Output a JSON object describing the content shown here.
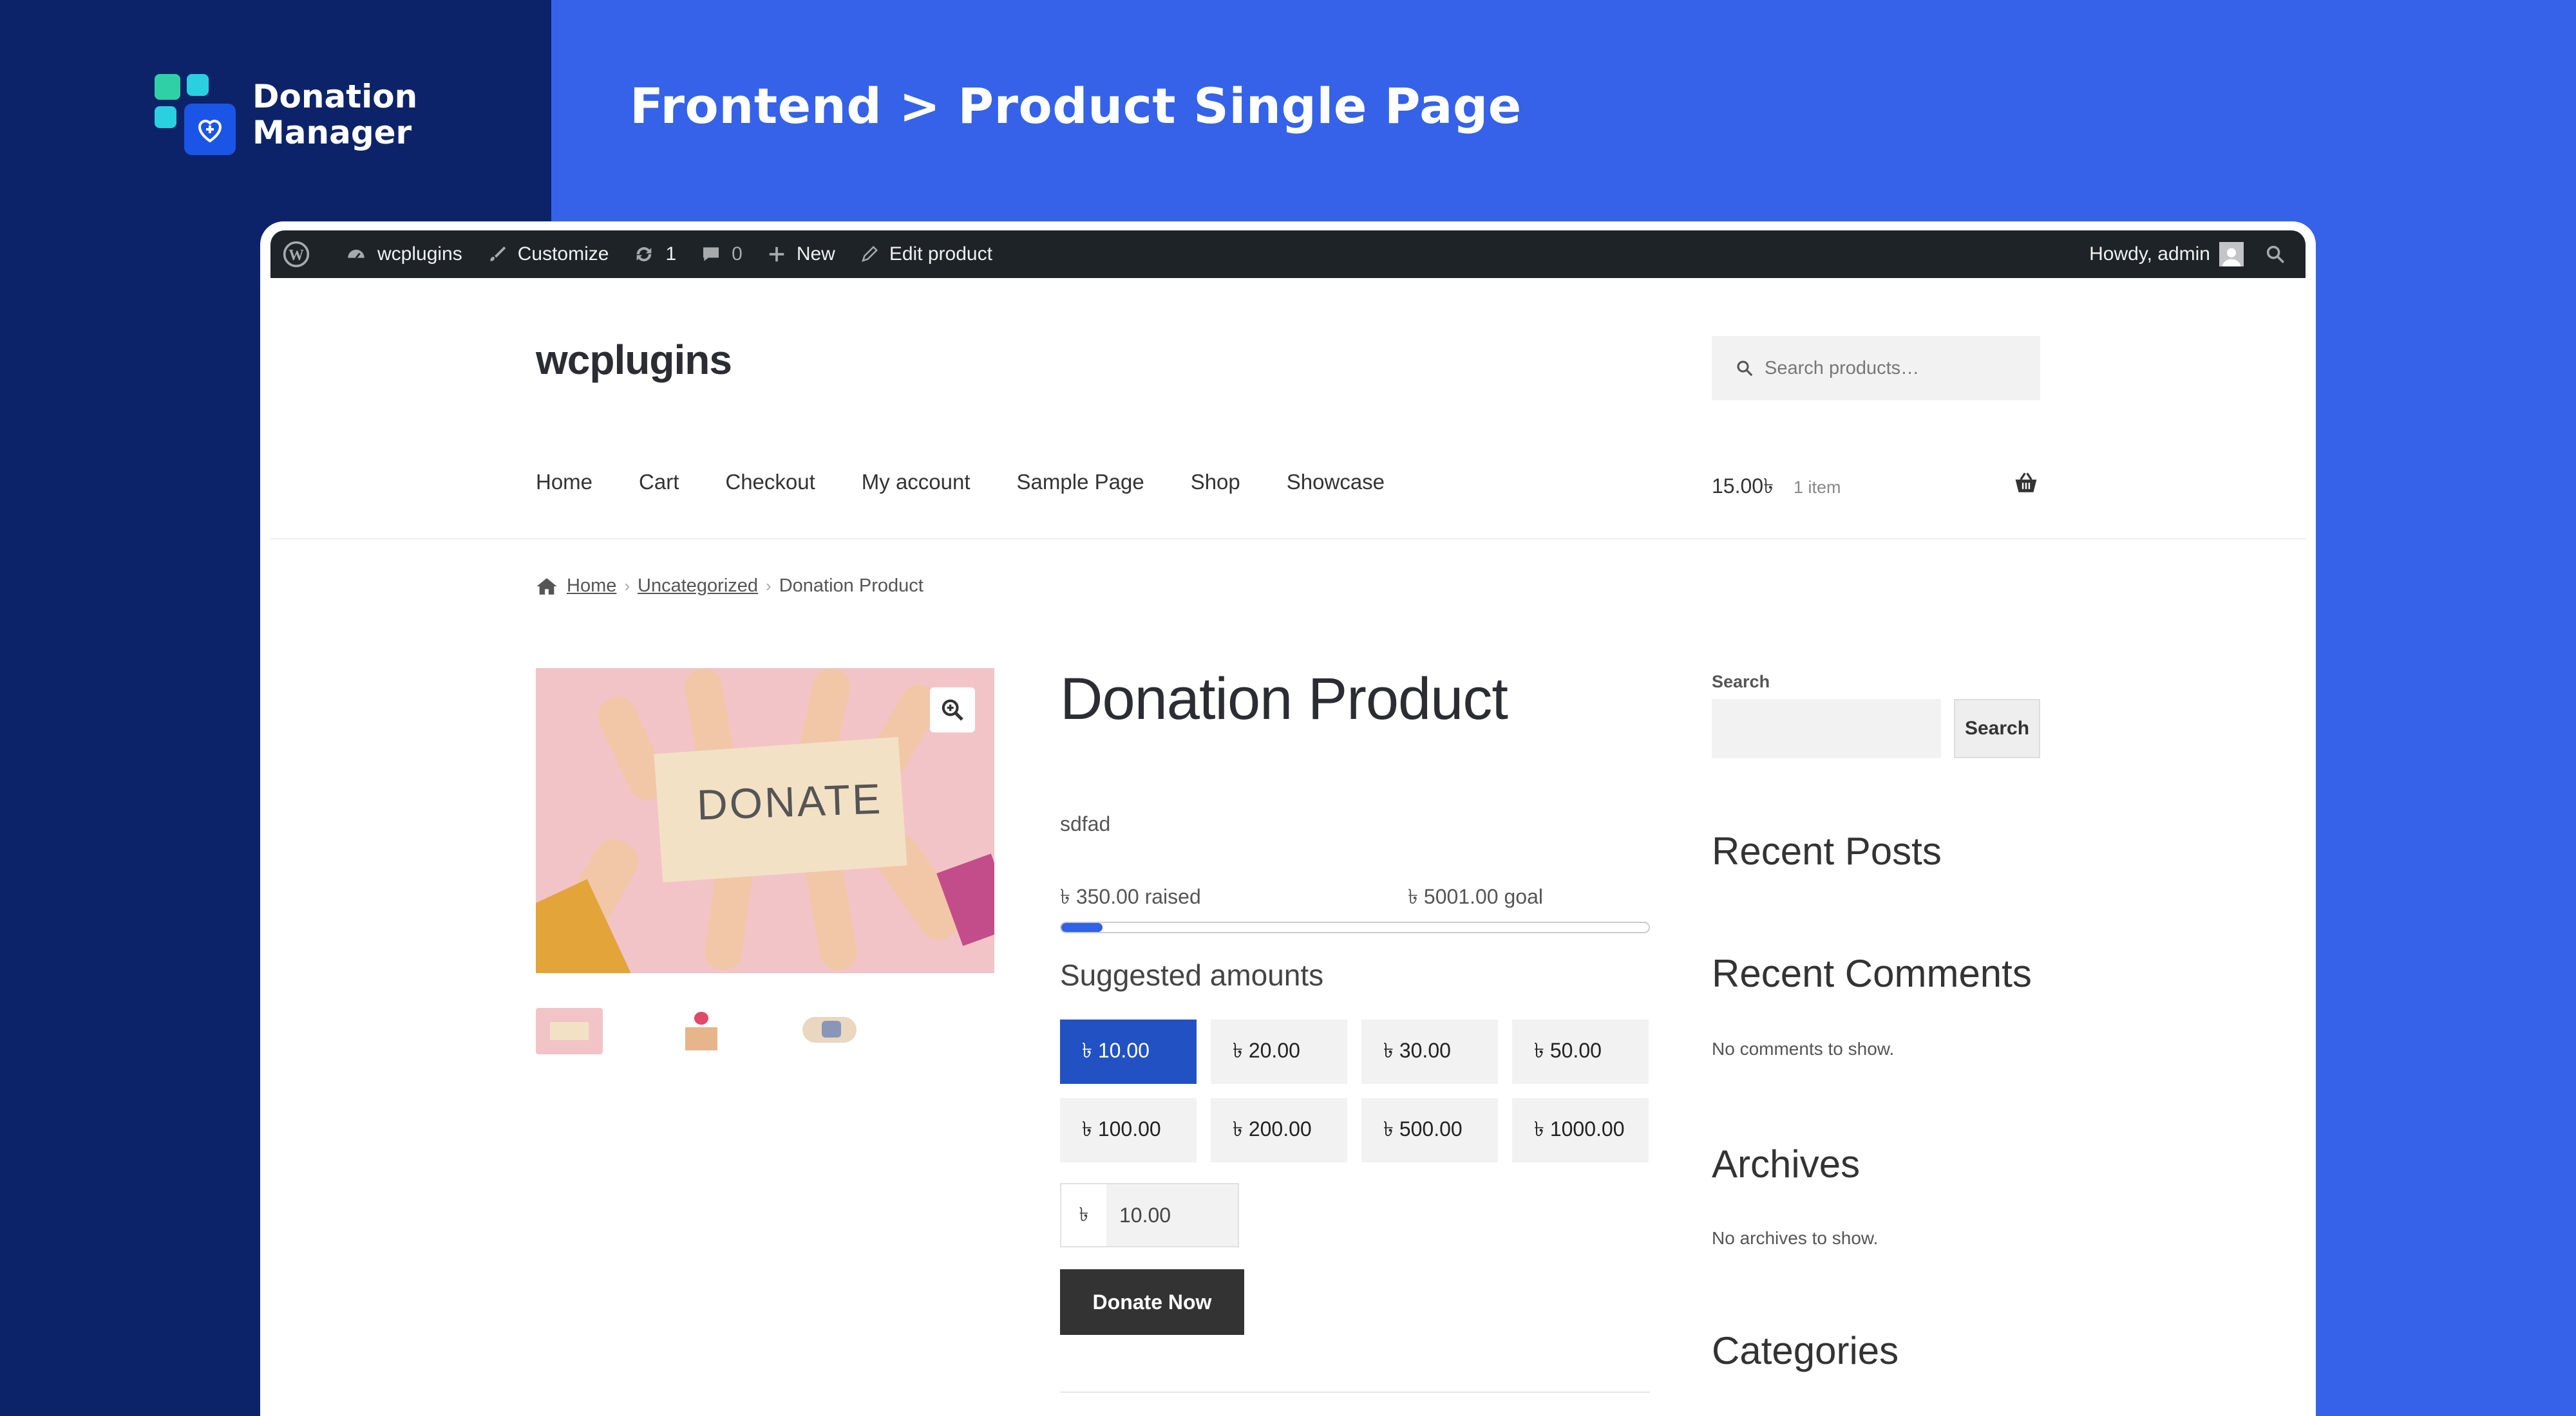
{
  "brand": {
    "line1": "Donation",
    "line2": "Manager"
  },
  "headline": "Frontend > Product Single Page",
  "adminbar": {
    "site": "wcplugins",
    "customize": "Customize",
    "updates": "1",
    "comments": "0",
    "new": "New",
    "edit": "Edit product",
    "howdy": "Howdy, admin"
  },
  "site": {
    "title": "wcplugins",
    "search_placeholder": "Search products…"
  },
  "nav": [
    "Home",
    "Cart",
    "Checkout",
    "My account",
    "Sample Page",
    "Shop",
    "Showcase"
  ],
  "cart": {
    "total": "15.00৳",
    "count": "1 item"
  },
  "breadcrumb": {
    "home": "Home",
    "category": "Uncategorized",
    "current": "Donation Product"
  },
  "product": {
    "image_text": "DONATE",
    "title": "Donation Product",
    "description": "sdfad",
    "raised_label": "৳ 350.00 raised",
    "goal_label": "৳ 5001.00 goal",
    "progress": 0.07,
    "suggested_title": "Suggested amounts",
    "amounts": [
      "৳ 10.00",
      "৳ 20.00",
      "৳ 30.00",
      "৳ 50.00",
      "৳ 100.00",
      "৳ 200.00",
      "৳ 500.00",
      "৳ 1000.00"
    ],
    "selected_amount_index": 0,
    "currency_symbol": "৳",
    "custom_amount": "10.00",
    "donate_button": "Donate Now"
  },
  "sidebar": {
    "search_label": "Search",
    "search_button": "Search",
    "recent_posts": "Recent Posts",
    "recent_comments": "Recent Comments",
    "no_comments": "No comments to show.",
    "archives": "Archives",
    "no_archives": "No archives to show.",
    "categories": "Categories"
  },
  "colors": {
    "left_panel": "#0d2369",
    "background": "#3562e8",
    "accent": "#2251c4",
    "adminbar": "#1d2327"
  }
}
